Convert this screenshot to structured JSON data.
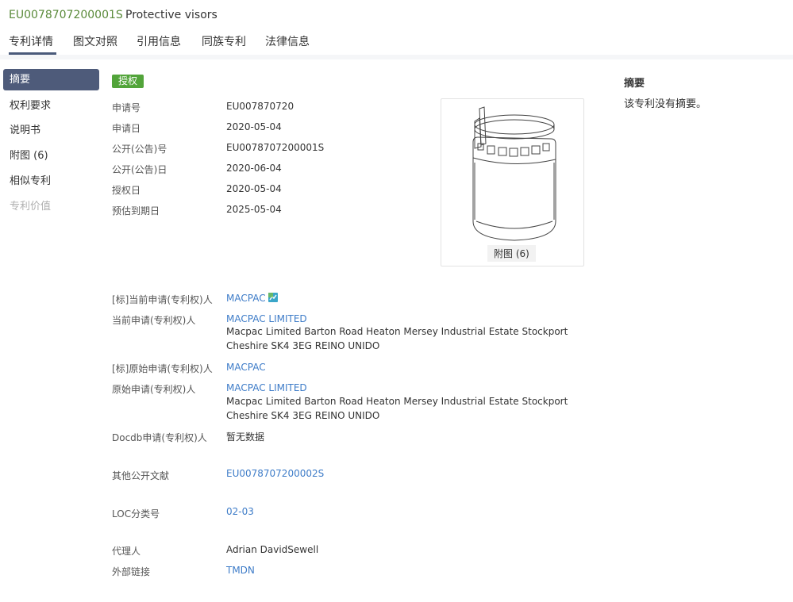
{
  "header": {
    "doc_id": "EU0078707200001S",
    "title": "Protective visors"
  },
  "tabs": [
    {
      "label": "专利详情"
    },
    {
      "label": "图文对照"
    },
    {
      "label": "引用信息"
    },
    {
      "label": "同族专利"
    },
    {
      "label": "法律信息"
    }
  ],
  "sidebar": {
    "items": [
      {
        "label": "摘要"
      },
      {
        "label": "权利要求"
      },
      {
        "label": "说明书"
      },
      {
        "label": "附图 (6)"
      },
      {
        "label": "相似专利"
      },
      {
        "label": "专利价值"
      }
    ]
  },
  "status_badge": "授权",
  "details": {
    "app_no_label": "申请号",
    "app_no": "EU007870720",
    "app_date_label": "申请日",
    "app_date": "2020-05-04",
    "pub_no_label": "公开(公告)号",
    "pub_no": "EU0078707200001S",
    "pub_date_label": "公开(公告)日",
    "pub_date": "2020-06-04",
    "grant_date_label": "授权日",
    "grant_date": "2020-05-04",
    "expiry_label": "预估到期日",
    "expiry": "2025-05-04"
  },
  "figure": {
    "caption": "附图 (6)",
    "icon": "patent-drawing-face-shield"
  },
  "parties": {
    "std_current_label": "[标]当前申请(专利权)人",
    "std_current": "MACPAC",
    "current_label": "当前申请(专利权)人",
    "current": "MACPAC LIMITED",
    "current_addr_1": "Macpac Limited Barton Road Heaton Mersey Industrial Estate Stockport",
    "current_addr_2": "Cheshire SK4 3EG REINO UNIDO",
    "std_original_label": "[标]原始申请(专利权)人",
    "std_original": "MACPAC",
    "original_label": "原始申请(专利权)人",
    "original": "MACPAC LIMITED",
    "original_addr_1": "Macpac Limited Barton Road Heaton Mersey Industrial Estate Stockport",
    "original_addr_2": "Cheshire SK4 3EG REINO UNIDO",
    "docdb_label": "Docdb申请(专利权)人",
    "docdb": "暂无数据"
  },
  "other": {
    "other_pub_label": "其他公开文献",
    "other_pub": "EU0078707200002S",
    "loc_label": "LOC分类号",
    "loc": "02-03",
    "agent_label": "代理人",
    "agent": "Adrian DavidSewell",
    "ext_link_label": "外部链接",
    "ext_link": "TMDN"
  },
  "abstract": {
    "title": "摘要",
    "text": "该专利没有摘要。"
  },
  "colors": {
    "doc_id": "#5a8a3a",
    "badge": "#52a43a",
    "sidebar_active": "#4e5b7a",
    "link": "#3e7cc8"
  }
}
